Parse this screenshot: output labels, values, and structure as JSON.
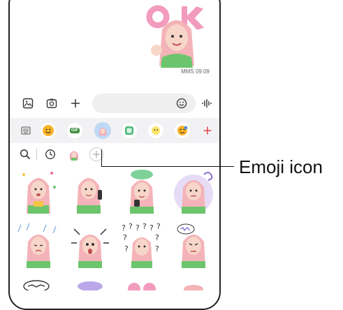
{
  "message": {
    "timestamp": "MMS 09:09"
  },
  "compose": {
    "left_icons": [
      "gallery-icon",
      "camera-icon",
      "plus-icon"
    ],
    "right_icons": [
      "emoji-smiley-icon",
      "voice-icon"
    ]
  },
  "sticker_bar": {
    "items": [
      "keyboard-icon",
      "emoji-face-icon",
      "gif-icon",
      "ar-emoji-icon",
      "sticker-icon",
      "bitmoji-icon",
      "emoji-sticker-icon",
      "add-icon"
    ],
    "gif_label": "GIF"
  },
  "filter_row": {
    "items": [
      "search-icon",
      "recent-icon",
      "ar-emoji-avatar-icon",
      "add-icon"
    ]
  },
  "callout": {
    "label": "Emoji icon"
  },
  "colors": {
    "accent_red": "#e5484d",
    "pink": "#f2a7b8",
    "green": "#6cc56c"
  }
}
